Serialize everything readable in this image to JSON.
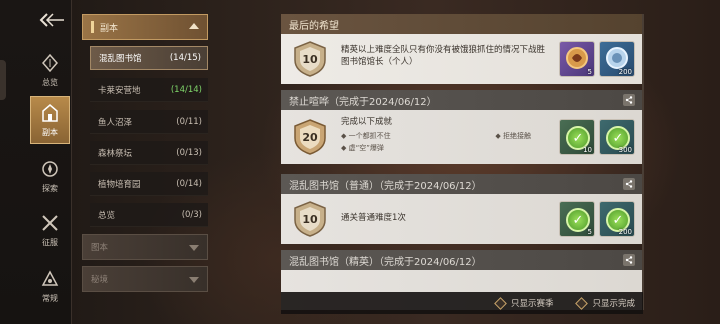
{
  "rail": {
    "items": [
      {
        "label": "总览",
        "icon": "overview-icon"
      },
      {
        "label": "副本",
        "icon": "dungeon-icon"
      },
      {
        "label": "探索",
        "icon": "compass-icon"
      },
      {
        "label": "征服",
        "icon": "swords-icon"
      },
      {
        "label": "常规",
        "icon": "triangle-icon"
      }
    ]
  },
  "categories": {
    "header": "副本",
    "items": [
      {
        "label": "混乱图书馆",
        "count": "(14/15)"
      },
      {
        "label": "卡莱安营地",
        "count": "(14/14)"
      },
      {
        "label": "鱼人沼泽",
        "count": "(0/11)"
      },
      {
        "label": "森林祭坛",
        "count": "(0/13)"
      },
      {
        "label": "植物培育园",
        "count": "(0/14)"
      },
      {
        "label": "总览",
        "count": "(0/3)"
      }
    ],
    "groups": [
      "图本",
      "秘境"
    ]
  },
  "achievements": [
    {
      "title": "最后的希望",
      "points": "10",
      "desc": "精英以上难度全队只有你没有被饿狼抓住的情况下战胜图书馆馆长（个人）",
      "rewards": [
        "5",
        "200"
      ]
    },
    {
      "title": "禁止喧哗（完成于2024/06/12）",
      "points": "20",
      "desc": "完成以下成就",
      "subs": [
        "一个都抓不住",
        "拒绝接触",
        "虚“空”爆弹"
      ],
      "rewards": [
        "10",
        "300"
      ]
    },
    {
      "title": "混乱图书馆（普通）（完成于2024/06/12）",
      "points": "10",
      "desc": "通关普通难度1次",
      "rewards": [
        "5",
        "200"
      ]
    },
    {
      "title": "混乱图书馆（精英）（完成于2024/06/12）"
    }
  ],
  "footer": {
    "season_only": "只显示赛季",
    "completed_only": "只显示完成"
  },
  "colors": {
    "accent": "#b88a4a",
    "complete": "#7fd66a"
  }
}
